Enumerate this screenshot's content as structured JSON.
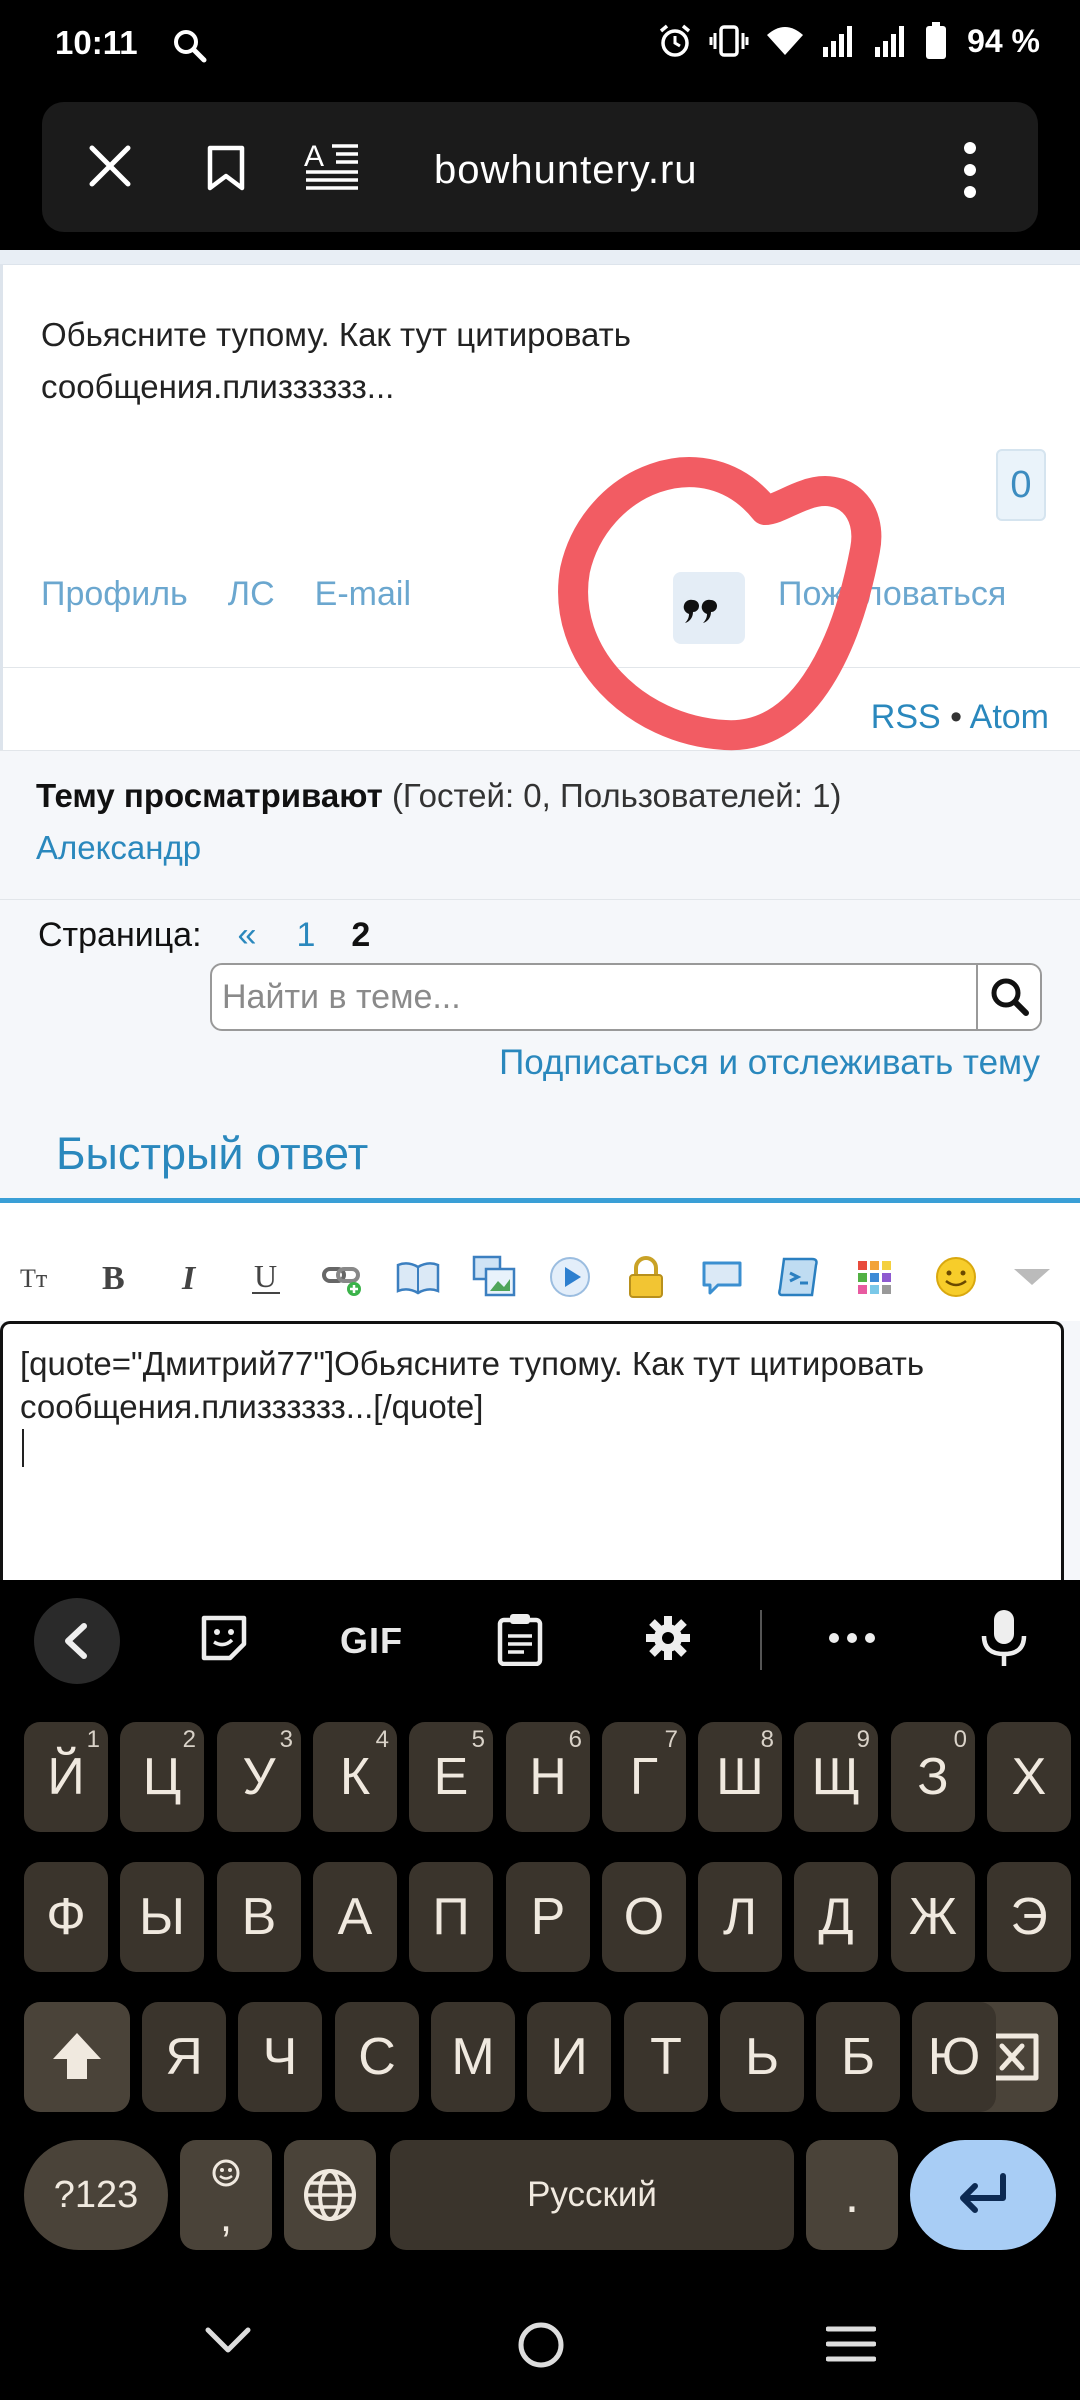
{
  "status_bar": {
    "time": "10:11",
    "battery": "94 %"
  },
  "browser": {
    "url": "bowhuntery.ru"
  },
  "post": {
    "text": "Обьясните тупому. Как тут цитировать сообщения.плизззззз...",
    "likes": "0",
    "actions": [
      "Профиль",
      "ЛС",
      "E-mail"
    ],
    "complain": "Пожаловаться"
  },
  "feeds": {
    "rss": "RSS",
    "separator": "•",
    "atom": "Atom"
  },
  "viewers": {
    "label": "Тему просматривают",
    "counts": "(Гостей: 0, Пользователей: 1)",
    "user": "Александр"
  },
  "pagination": {
    "label": "Страница:",
    "prev": "«",
    "pages": [
      "1",
      "2"
    ],
    "current": "2"
  },
  "search": {
    "placeholder": "Найти в теме..."
  },
  "subscribe": "Подписаться и отслеживать тему",
  "quick_reply": {
    "title": "Быстрый ответ",
    "editor_line1": "[quote=\"Дмитрий77\"]Обьясните тупому. Как тут цитировать",
    "editor_line2": "сообщения.плизззззз...[/quote]"
  },
  "keyboard": {
    "gif": "GIF",
    "row1": [
      {
        "k": "Й",
        "h": "1"
      },
      {
        "k": "Ц",
        "h": "2"
      },
      {
        "k": "У",
        "h": "3"
      },
      {
        "k": "К",
        "h": "4"
      },
      {
        "k": "Е",
        "h": "5"
      },
      {
        "k": "Н",
        "h": "6"
      },
      {
        "k": "Г",
        "h": "7"
      },
      {
        "k": "Ш",
        "h": "8"
      },
      {
        "k": "Щ",
        "h": "9"
      },
      {
        "k": "З",
        "h": "0"
      },
      {
        "k": "Х",
        "h": ""
      }
    ],
    "row2": [
      "Ф",
      "Ы",
      "В",
      "А",
      "П",
      "Р",
      "О",
      "Л",
      "Д",
      "Ж",
      "Э"
    ],
    "row3": [
      "Я",
      "Ч",
      "С",
      "М",
      "И",
      "Т",
      "Ь",
      "Б",
      "Ю"
    ],
    "sym_key": "?123",
    "emoji_comma": ",",
    "space": "Русский",
    "period": "."
  },
  "colors": {
    "link": "#2a88bd",
    "accent_line": "#3a9fd6",
    "annotation": "#f25c63",
    "key_bg": "#3a342c",
    "enter_bg": "#a8cdf5"
  }
}
